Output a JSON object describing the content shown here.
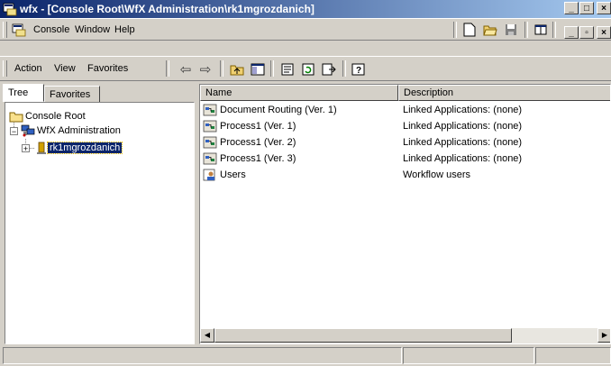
{
  "window": {
    "title": "wfx - [Console Root\\WfX Administration\\rk1mgrozdanich]",
    "minimize_glyph": "_",
    "maximize_glyph": "□",
    "close_glyph": "×"
  },
  "menubar": {
    "items": [
      {
        "label": "Console"
      },
      {
        "label": "Window"
      },
      {
        "label": "Help"
      }
    ],
    "mdi_min_glyph": "_",
    "mdi_restore_glyph": "▫",
    "mdi_close_glyph": "×"
  },
  "actionbar": {
    "items": [
      {
        "label": "Action"
      },
      {
        "label": "View"
      },
      {
        "label": "Favorites"
      }
    ],
    "back_glyph": "⇦",
    "forward_glyph": "⇨"
  },
  "left_pane": {
    "tabs": [
      {
        "label": "Tree"
      },
      {
        "label": "Favorites"
      }
    ],
    "tree": [
      {
        "label": "Console Root"
      },
      {
        "label": "WfX Administration",
        "expander": "−"
      },
      {
        "label": "rk1mgrozdanich",
        "expander": "+",
        "selected": true
      }
    ]
  },
  "list": {
    "columns": [
      {
        "label": "Name"
      },
      {
        "label": "Description"
      }
    ],
    "rows": [
      {
        "name": "Document Routing (Ver. 1)",
        "description": "Linked Applications: (none)",
        "icon": "process-icon"
      },
      {
        "name": "Process1 (Ver. 1)",
        "description": "Linked Applications: (none)",
        "icon": "process-icon"
      },
      {
        "name": "Process1 (Ver. 2)",
        "description": "Linked Applications: (none)",
        "icon": "process-icon"
      },
      {
        "name": "Process1 (Ver. 3)",
        "description": "Linked Applications: (none)",
        "icon": "process-icon"
      },
      {
        "name": "Users",
        "description": "Workflow users",
        "icon": "users-icon"
      }
    ]
  },
  "scrollbar": {
    "left_glyph": "◀",
    "right_glyph": "▶"
  },
  "colors": {
    "title_start": "#0a246a",
    "title_end": "#a6caf0",
    "face": "#d4d0c8",
    "selection": "#0a246a"
  }
}
